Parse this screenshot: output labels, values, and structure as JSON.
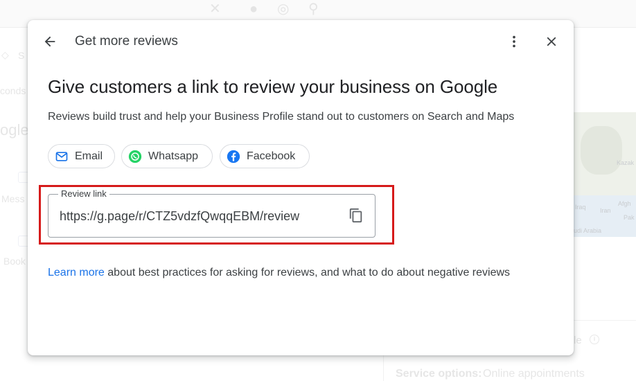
{
  "background": {
    "fragments": [
      "S",
      "conds",
      "ogle",
      "Mess",
      "Book",
      "le"
    ],
    "map_labels": [
      "Kazak",
      "Iraq",
      "Iran",
      "Afgh",
      "Pak",
      "udi Arabia"
    ],
    "service_label": "Service options:",
    "service_value": "Online appointments"
  },
  "dialog": {
    "title": "Get more reviews",
    "headline": "Give customers a link to review your business on Google",
    "subtext": "Reviews build trust and help your Business Profile stand out to customers on Search and Maps",
    "share_options": [
      {
        "label": "Email",
        "icon": "mail-icon"
      },
      {
        "label": "Whatsapp",
        "icon": "whatsapp-icon"
      },
      {
        "label": "Facebook",
        "icon": "facebook-icon"
      }
    ],
    "review_link": {
      "label": "Review link",
      "value": "https://g.page/r/CTZ5vdzfQwqqEBM/review"
    },
    "learn_more": {
      "link": "Learn more",
      "text": " about best practices for asking for reviews, and what to do about negative reviews"
    }
  },
  "colors": {
    "link": "#1a73e8",
    "highlight": "#d61a1a",
    "whatsapp": "#25d366",
    "facebook": "#1877f2",
    "email": "#1a73e8"
  }
}
